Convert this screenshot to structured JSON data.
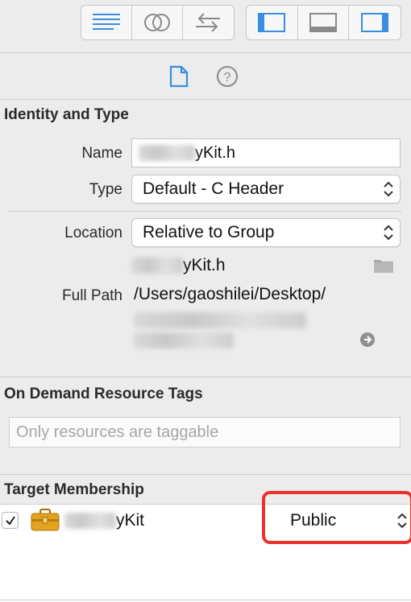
{
  "toolbar": {
    "left_group": [
      "lines-icon",
      "circles-icon",
      "arrows-icon"
    ],
    "right_group": [
      "left-panel-icon",
      "bottom-panel-icon",
      "right-panel-icon"
    ]
  },
  "inspector": {
    "tabs": [
      "file-icon",
      "help-icon"
    ]
  },
  "identity": {
    "title": "Identity and Type",
    "name_label": "Name",
    "name_value": "kit.h",
    "name_suffix": "yKit.h",
    "type_label": "Type",
    "type_value": "Default - C Header",
    "location_label": "Location",
    "location_value": "Relative to Group",
    "location_file": "yKit.h",
    "full_path_label": "Full Path",
    "full_path_value": "/Users/gaoshilei/Desktop/"
  },
  "odr": {
    "title": "On Demand Resource Tags",
    "placeholder": "Only resources are taggable"
  },
  "target": {
    "title": "Target Membership",
    "target_name_suffix": "yKit",
    "visibility": "Public",
    "checked": true
  },
  "colors": {
    "accent": "#3a8de0",
    "highlight": "#e8322d",
    "background": "#ececec"
  }
}
